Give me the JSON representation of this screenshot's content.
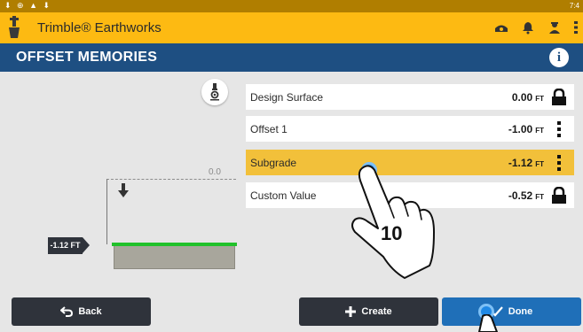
{
  "status_bar": {
    "time": "7:4"
  },
  "app_bar": {
    "title": "Trimble® Earthworks"
  },
  "title_bar": {
    "title": "OFFSET MEMORIES",
    "info_glyph": "i"
  },
  "diagram": {
    "reference_label": "0.0",
    "level_tag": "-1.12 FT"
  },
  "offsets": [
    {
      "name": "Design Surface",
      "value": "0.00",
      "unit": "FT",
      "icon": "lock-icon",
      "selected": false
    },
    {
      "name": "Offset 1",
      "value": "-1.00",
      "unit": "FT",
      "icon": "kebab-menu-icon",
      "selected": false
    },
    {
      "name": "Subgrade",
      "value": "-1.12",
      "unit": "FT",
      "icon": "kebab-menu-icon",
      "selected": true
    },
    {
      "name": "Custom Value",
      "value": "-0.52",
      "unit": "FT",
      "icon": "lock-icon",
      "selected": false
    }
  ],
  "buttons": {
    "back": "Back",
    "create": "Create",
    "done": "Done"
  },
  "annotation": {
    "step_number": "10"
  },
  "colors": {
    "app_bar": "#fdba12",
    "title_bar": "#1e4f82",
    "selected_row": "#f2c03a",
    "done_button": "#1f6fb8",
    "dark_button": "#2f333b",
    "surface_line": "#21c12a"
  }
}
